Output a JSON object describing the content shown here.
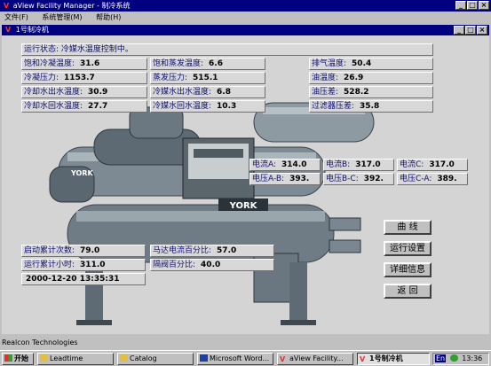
{
  "window": {
    "title": "aView Facility Manager - 制冷系统",
    "menu": [
      "文件(F)",
      "系统管理(M)",
      "帮助(H)"
    ]
  },
  "child": {
    "title": "1号制冷机"
  },
  "fields": {
    "status": "运行状态: 冷媒水温度控制中。",
    "sat_cond_temp_label": "饱和冷凝温度:",
    "sat_cond_temp": "31.6",
    "sat_evap_temp_label": "饱和蒸发温度:",
    "sat_evap_temp": "6.6",
    "exhaust_temp_label": "排气温度:",
    "exhaust_temp": "50.4",
    "cond_press_label": "冷凝压力:",
    "cond_press": "1153.7",
    "evap_press_label": "蒸发压力:",
    "evap_press": "515.1",
    "oil_temp_label": "油温度:",
    "oil_temp": "26.9",
    "cw_out_label": "冷却水出水温度:",
    "cw_out": "30.9",
    "chw_out_label": "冷媒水出水温度:",
    "chw_out": "6.8",
    "oil_press_label": "油压差:",
    "oil_press": "528.2",
    "cw_ret_label": "冷却水回水温度:",
    "cw_ret": "27.7",
    "chw_ret_label": "冷媒水回水温度:",
    "chw_ret": "10.3",
    "filter_label": "过滤器压差:",
    "filter": "35.8",
    "ia_label": "电流A:",
    "ia": "314.0",
    "ib_label": "电流B:",
    "ib": "317.0",
    "ic_label": "电流C:",
    "ic": "317.0",
    "vab_label": "电压A-B:",
    "vab": "393.",
    "vbc_label": "电压B-C:",
    "vbc": "392.",
    "vca_label": "电压C-A:",
    "vca": "389.",
    "starts_label": "启动累计次数:",
    "starts": "79.0",
    "motor_pct_label": "马达电流百分比:",
    "motor_pct": "57.0",
    "hours_label": "运行累计小时:",
    "hours": "311.0",
    "vane_label": "隔阀百分比:",
    "vane": "40.0",
    "datetime": "2000-12-20  13:35:31"
  },
  "buttons": {
    "curve": "曲  线",
    "settings": "运行设置",
    "details": "详细信息",
    "back": "返  回"
  },
  "statusbar": "Realcon Technologies",
  "taskbar": {
    "start": "开始",
    "items": [
      "Leadtime",
      "Catalog",
      "Microsoft Word...",
      "aView Facility...",
      "1号制冷机"
    ],
    "lang": "En",
    "clock": "13:36"
  },
  "brand": "YORK",
  "colors": {
    "title_bg": "#000080",
    "face": "#c0c0c0",
    "work": "#d4d4d4"
  }
}
